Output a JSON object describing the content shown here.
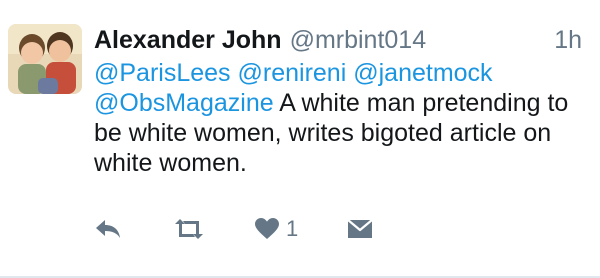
{
  "tweet": {
    "author_name": "Alexander John",
    "author_handle": "@mrbint014",
    "time": "1h",
    "mentions": [
      "@ParisLees",
      "@renireni",
      "@janetmock",
      "@ObsMagazine"
    ],
    "body_text": "A white man pretending to be white women, writes bigoted article on white women.",
    "actions": {
      "reply_icon": "reply-icon",
      "retweet_icon": "retweet-icon",
      "like_icon": "heart-icon",
      "like_count": "1",
      "dm_icon": "envelope-icon"
    }
  },
  "colors": {
    "link": "#1b95e0",
    "text": "#14171a",
    "muted": "#657786",
    "icon": "#657786"
  }
}
